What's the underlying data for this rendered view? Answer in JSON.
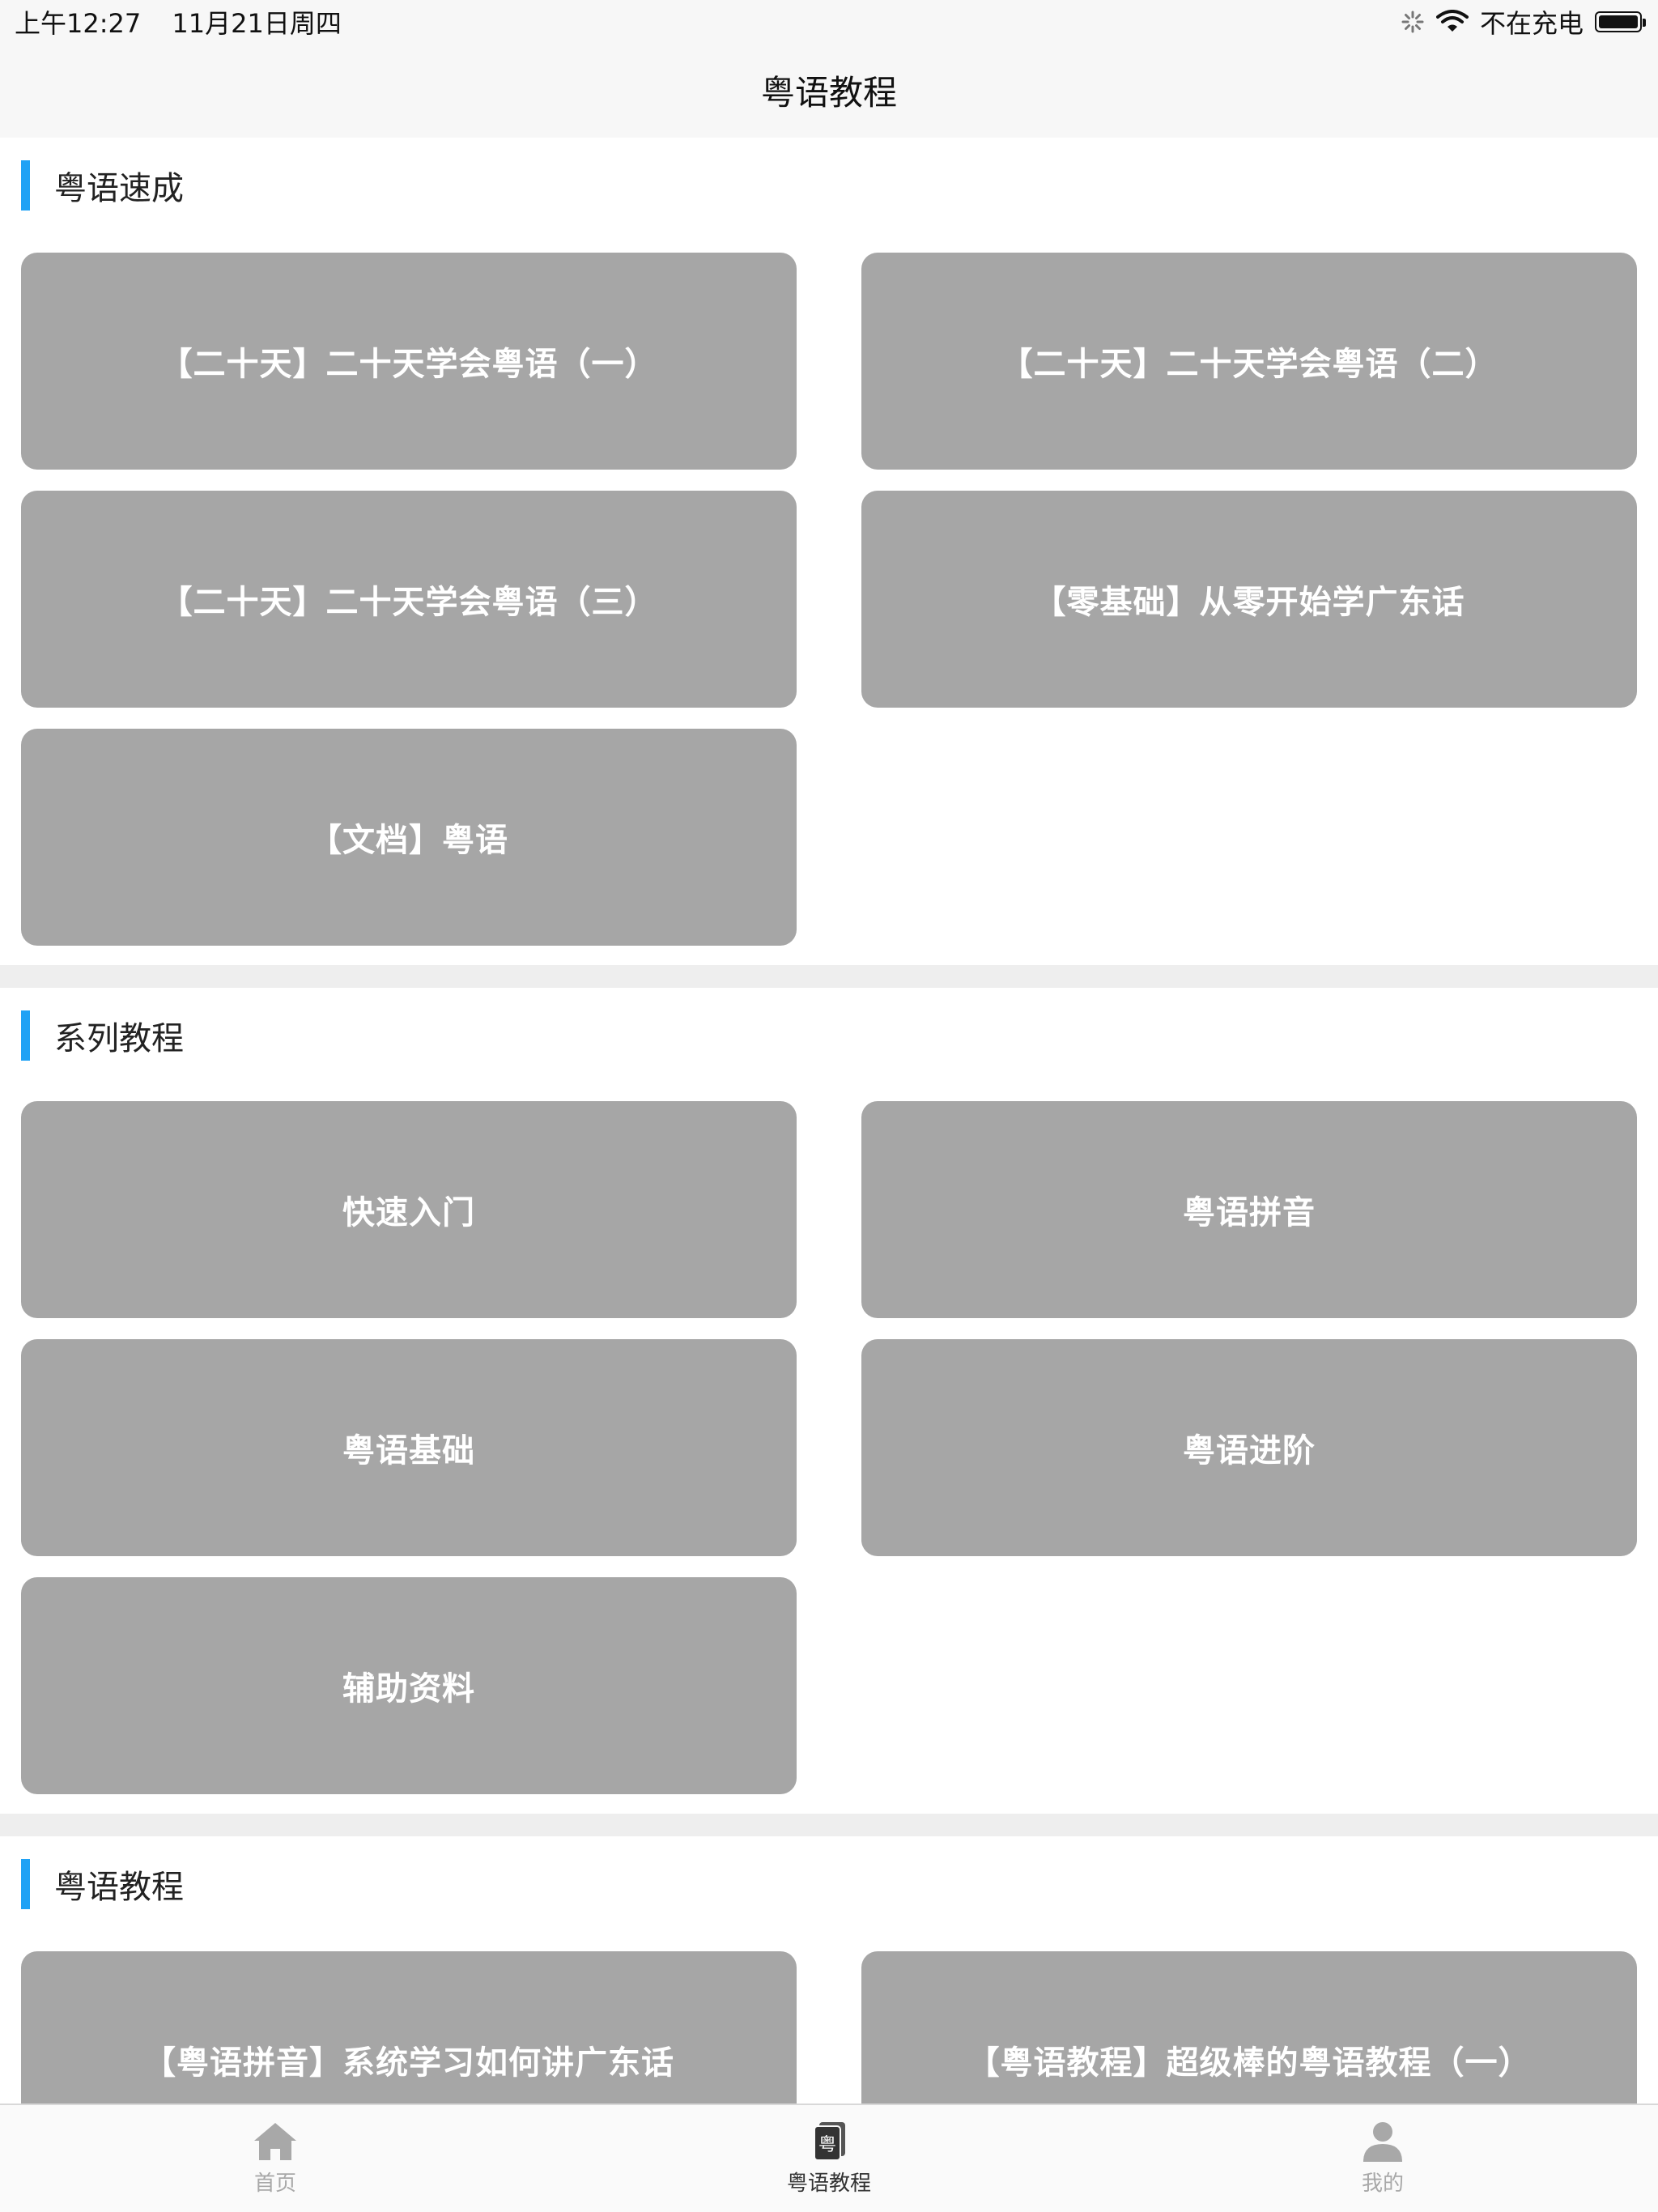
{
  "status_bar": {
    "time": "上午12:27",
    "date": "11月21日周四",
    "charging": "不在充电"
  },
  "nav": {
    "title": "粤语教程"
  },
  "sections": [
    {
      "title": "粤语速成",
      "items": [
        "【二十天】二十天学会粤语（一）",
        "【二十天】二十天学会粤语（二）",
        "【二十天】二十天学会粤语（三）",
        "【零基础】从零开始学广东话",
        "【文档】粤语"
      ]
    },
    {
      "title": "系列教程",
      "items": [
        "快速入门",
        "粤语拼音",
        "粤语基础",
        "粤语进阶",
        "辅助资料"
      ]
    },
    {
      "title": "粤语教程",
      "items": [
        "【粤语拼音】系统学习如何讲广东话",
        "【粤语教程】超级棒的粤语教程（一）"
      ]
    }
  ],
  "tabbar": {
    "tabs": [
      {
        "label": "首页",
        "icon": "home-icon",
        "active": false
      },
      {
        "label": "粤语教程",
        "icon": "book-icon",
        "active": true
      },
      {
        "label": "我的",
        "icon": "person-icon",
        "active": false
      }
    ],
    "book_icon_char": "粤",
    "active_color": "#333333",
    "inactive_color": "#a8a8a8"
  },
  "colors": {
    "accent": "#1fa2f5",
    "card_bg": "#a6a6a6",
    "divider": "#eeeeee"
  }
}
